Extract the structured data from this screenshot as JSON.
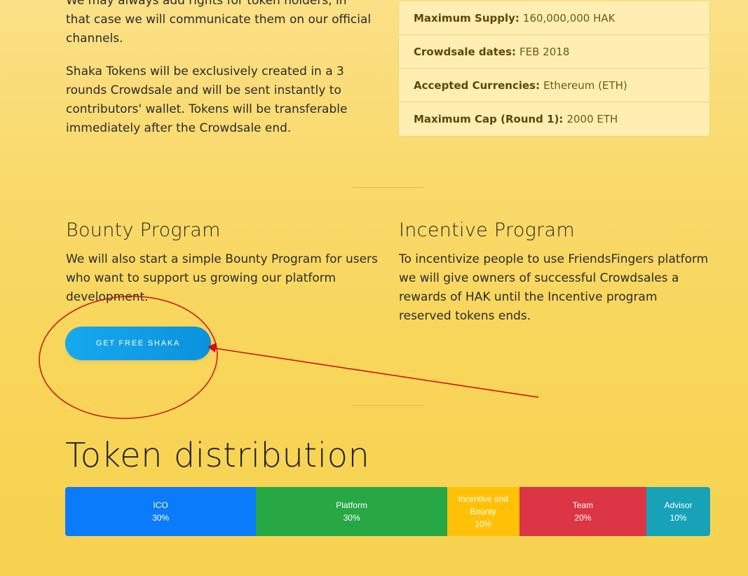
{
  "intro": {
    "p1": "We may always add rights for token holders, in that case we will communicate them on our official channels.",
    "p2": "Shaka Tokens will be exclusively created in a 3 rounds Crowdsale and will be sent instantly to contributors' wallet. Tokens will be transferable immediately after the Crowdsale end."
  },
  "facts": [
    {
      "label": "Maximum Supply:",
      "value": "160,000,000 HAK"
    },
    {
      "label": "Crowdsale dates:",
      "value": "FEB 2018"
    },
    {
      "label": "Accepted Currencies:",
      "value": "Ethereum (ETH)"
    },
    {
      "label": "Maximum Cap (Round 1):",
      "value": "2000 ETH"
    }
  ],
  "bounty": {
    "title": "Bounty Program",
    "text": "We will also start a simple Bounty Program for users who want to support us growing our platform development.",
    "button_label": "GET FREE SHAKA"
  },
  "incentive": {
    "title": "Incentive Program",
    "text": "To incentivize people to use FriendsFingers platform we will give owners of successful Crowdsales a rewards of HAK until the Incentive program reserved tokens ends."
  },
  "distribution": {
    "title": "Token distribution",
    "segments": [
      {
        "label": "ICO",
        "percent": "30%",
        "share": 30,
        "color": "#0a7bfb"
      },
      {
        "label": "Platform",
        "percent": "30%",
        "share": 30,
        "color": "#27a844"
      },
      {
        "label": "Incentive and Bounty",
        "percent": "10%",
        "share": 10,
        "color": "#ffc107"
      },
      {
        "label": "Team",
        "percent": "20%",
        "share": 20,
        "color": "#dc3545"
      },
      {
        "label": "Advisor",
        "percent": "10%",
        "share": 10,
        "color": "#17a2b8"
      }
    ]
  },
  "annotation": {
    "color": "#d01010"
  }
}
